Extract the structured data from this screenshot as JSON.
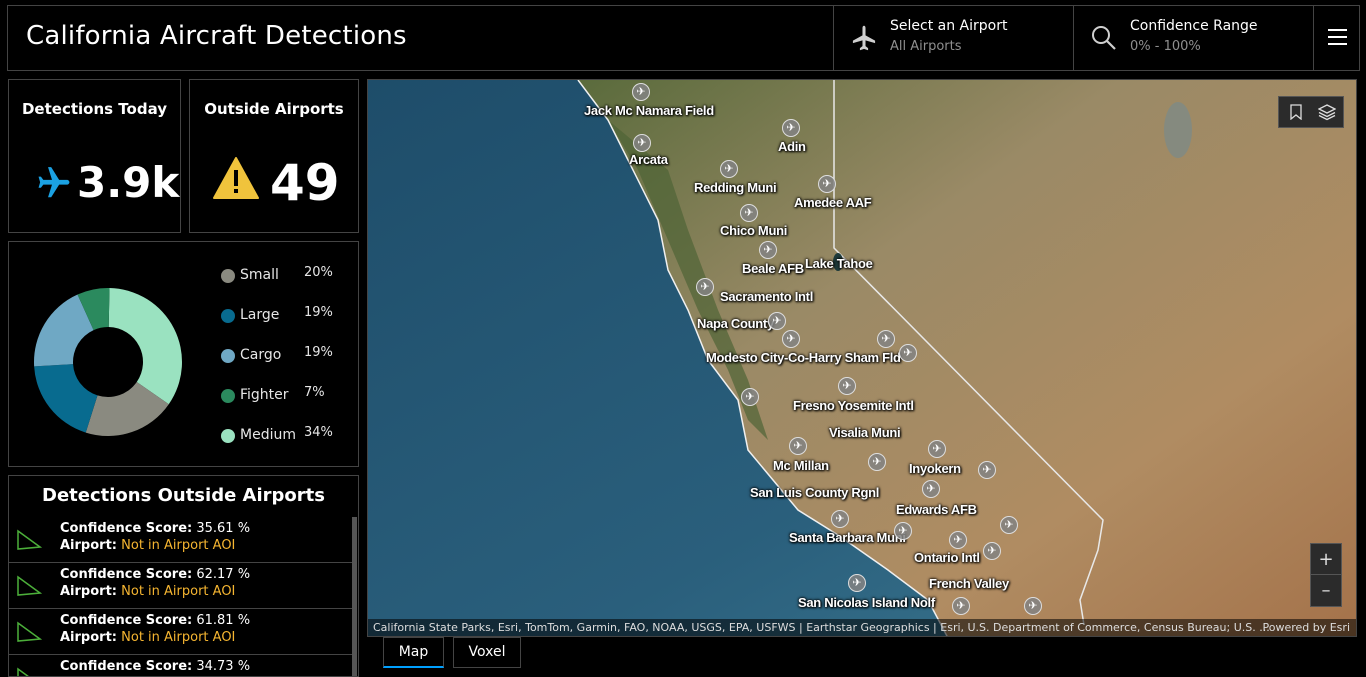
{
  "header": {
    "title": "California Aircraft Detections",
    "airport_label": "Select an Airport",
    "airport_value": "All Airports",
    "confidence_label": "Confidence Range",
    "confidence_value": "0% - 100%"
  },
  "kpis": {
    "detections_title": "Detections Today",
    "detections_value": "3.9k",
    "outside_title": "Outside Airports",
    "outside_value": "49"
  },
  "donut": {
    "items": [
      {
        "label": "Small",
        "percent": "20%",
        "color": "#8a8a80"
      },
      {
        "label": "Large",
        "percent": "19%",
        "color": "#086b8f"
      },
      {
        "label": "Cargo",
        "percent": "19%",
        "color": "#6fa8c4"
      },
      {
        "label": "Fighter",
        "percent": "7%",
        "color": "#2b8a5e"
      },
      {
        "label": "Medium",
        "percent": "34%",
        "color": "#9ae2c0"
      }
    ]
  },
  "detections_list": {
    "title": "Detections Outside Airports",
    "score_label": "Confidence Score:",
    "airport_label": "Airport:",
    "items": [
      {
        "score": "35.61 %",
        "airport": "Not in Airport AOI"
      },
      {
        "score": "62.17 %",
        "airport": "Not in Airport AOI"
      },
      {
        "score": "61.81 %",
        "airport": "Not in Airport AOI"
      },
      {
        "score": "34.73 %",
        "airport": ""
      }
    ]
  },
  "map": {
    "airports": [
      "Jack Mc Namara Field",
      "Arcata",
      "Adin",
      "Redding Muni",
      "Amedee AAF",
      "Chico Muni",
      "Beale AFB",
      "Lake Tahoe",
      "Sacramento Intl",
      "Napa County",
      "Modesto City-Co-Harry Sham Fld",
      "Fresno Yosemite Intl",
      "Visalia Muni",
      "Mc Millan",
      "Inyokern",
      "San Luis County Rgnl",
      "Edwards AFB",
      "Santa Barbara Muni",
      "Ontario Intl",
      "French Valley",
      "San Nicolas Island Nolf"
    ],
    "attribution": "California State Parks, Esri, TomTom, Garmin, FAO, NOAA, USGS, EPA, USFWS | Earthstar Geographics | Esri, U.S. Department of Commerce, Census Bureau; U.S. ...",
    "powered_by": "Powered by Esri",
    "zoom_in": "+",
    "zoom_out": "–"
  },
  "tabs": {
    "map": "Map",
    "voxel": "Voxel"
  },
  "colors": {
    "accent": "#1ba1e2",
    "warning": "#f0c33c",
    "aoi_text": "#f5b531",
    "list_icon": "#4caf3a"
  }
}
